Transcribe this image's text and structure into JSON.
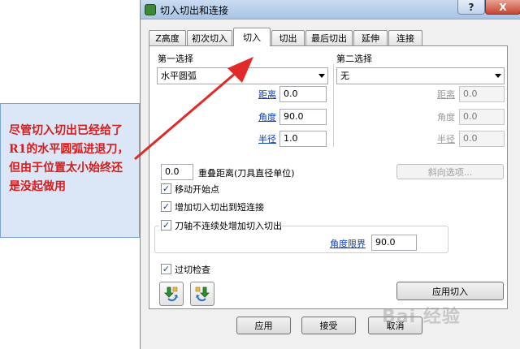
{
  "annotation": {
    "text": "尽管切入切出已经给了R1的水平圆弧进退刀，但由于位置太小始终还是没起做用"
  },
  "window": {
    "title": "切入切出和连接",
    "help_label": "?",
    "close_label": "X"
  },
  "tabs": [
    {
      "label": "Z高度"
    },
    {
      "label": "初次切入"
    },
    {
      "label": "切入"
    },
    {
      "label": "切出"
    },
    {
      "label": "最后切出"
    },
    {
      "label": "延伸"
    },
    {
      "label": "连接"
    }
  ],
  "active_tab": "切入",
  "first_choice": {
    "heading": "第一选择",
    "value": "水平圆弧",
    "distance_label": "距离",
    "distance_value": "0.0",
    "angle_label": "角度",
    "angle_value": "90.0",
    "radius_label": "半径",
    "radius_value": "1.0"
  },
  "second_choice": {
    "heading": "第二选择",
    "value": "无",
    "distance_label": "距离",
    "distance_value": "0.0",
    "angle_label": "角度",
    "angle_value": "0.0",
    "radius_label": "半径",
    "radius_value": "0.0"
  },
  "overlap": {
    "value": "0.0",
    "label": "重叠距离(刀具直径单位)",
    "ramp_button": "斜向选项..."
  },
  "options": {
    "move_start": {
      "label": "移动开始点",
      "checked": true
    },
    "add_short_link": {
      "label": "增加切入切出到短连接",
      "checked": true
    },
    "axis_discontinuity": {
      "label": "刀轴不连续处增加切入切出",
      "checked": true
    },
    "angle_limit_label": "角度限界",
    "angle_limit_value": "90.0",
    "gouge_check": {
      "label": "过切检查",
      "checked": true
    }
  },
  "apply_leadin_button": "应用切入",
  "footer": {
    "apply": "应用",
    "accept": "接受",
    "cancel": "取消"
  },
  "watermark": "Bai 经验",
  "colors": {
    "callout_bg": "#dbe7f7",
    "callout_text": "#d81c1c",
    "arrow": "#e02a2a",
    "link": "#0a3fc2"
  }
}
